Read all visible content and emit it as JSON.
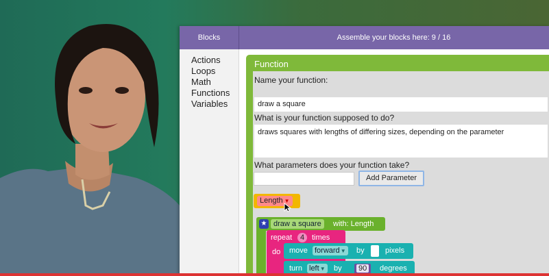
{
  "header": {
    "blocks_label": "Blocks",
    "workspace_label": "Assemble your blocks here: 9 / 16"
  },
  "toolbox": {
    "items": [
      {
        "label": "Actions"
      },
      {
        "label": "Loops"
      },
      {
        "label": "Math"
      },
      {
        "label": "Functions"
      },
      {
        "label": "Variables"
      }
    ]
  },
  "function_dialog": {
    "title": "Function",
    "name_label": "Name your function:",
    "name_value": "draw a square",
    "desc_label": "What is your function supposed to do?",
    "desc_value": "draws squares with lengths of differing sizes, depending on the parameter",
    "params_label": "What parameters does your function take?",
    "params_input_value": "",
    "add_param_label": "Add Parameter",
    "param_chip_label": "Length"
  },
  "blocks": {
    "def_name": "draw a square",
    "def_with": "with: Length",
    "repeat_label": "repeat",
    "repeat_count": "4",
    "times_label": "times",
    "do_label": "do",
    "move_label": "move",
    "move_direction": "forward",
    "move_by": "by",
    "move_unit": "pixels",
    "turn_label": "turn",
    "turn_direction": "left",
    "turn_by": "by",
    "turn_value": "90",
    "turn_unit": "degrees"
  },
  "colors": {
    "header": "#7866a8",
    "function_green": "#7fb93a",
    "loop_pink": "#e8257f",
    "action_teal": "#1ab1b0",
    "param_yellow": "#f2b700"
  }
}
